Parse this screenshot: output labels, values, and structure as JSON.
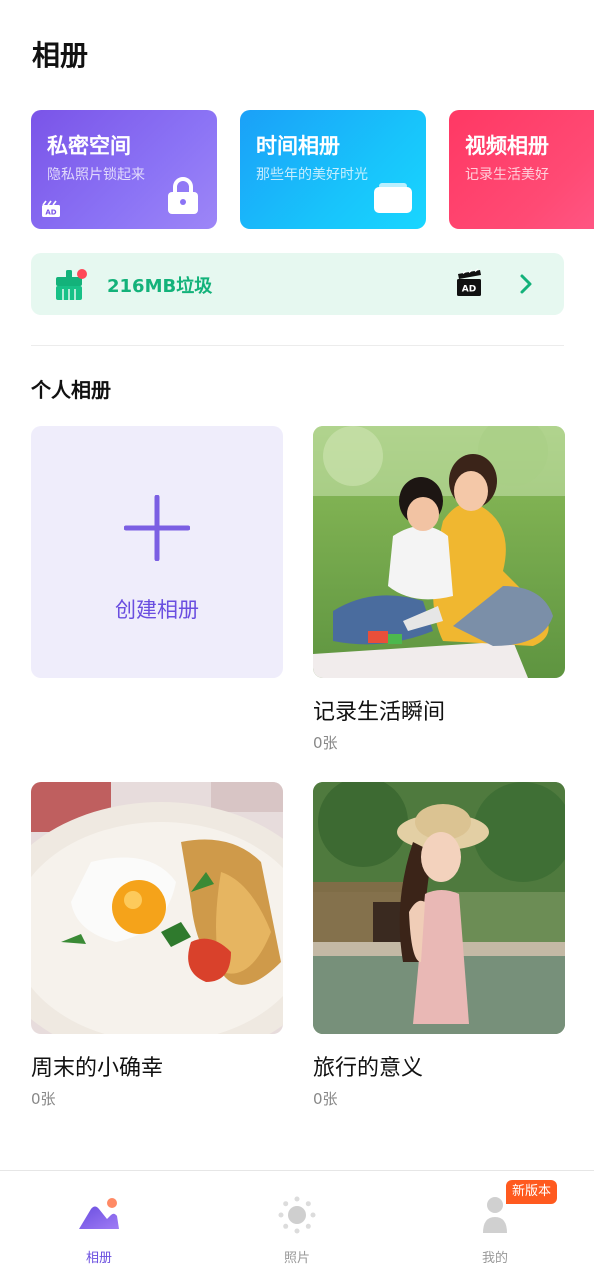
{
  "header": {
    "title": "相册"
  },
  "feature_cards": [
    {
      "title": "私密空间",
      "subtitle": "隐私照片锁起来",
      "ad": "AD",
      "icon": "lock-icon"
    },
    {
      "title": "时间相册",
      "subtitle": "那些年的美好时光",
      "icon": "folder-icon"
    },
    {
      "title": "视频相册",
      "subtitle": "记录生活美好",
      "icon": "film-icon"
    }
  ],
  "cleaner": {
    "text": "216MB垃圾",
    "ad": "AD",
    "icon": "broom-icon"
  },
  "section": {
    "title": "个人相册"
  },
  "create_album": {
    "label": "创建相册"
  },
  "albums": [
    {
      "name": "记录生活瞬间",
      "count": "0张"
    },
    {
      "name": "周末的小确幸",
      "count": "0张"
    },
    {
      "name": "旅行的意义",
      "count": "0张"
    }
  ],
  "tabbar": {
    "tabs": [
      {
        "label": "相册",
        "active": true
      },
      {
        "label": "照片",
        "active": false
      },
      {
        "label": "我的",
        "active": false
      }
    ],
    "new_badge": "新版本"
  },
  "colors": {
    "accent": "#6a4ee0",
    "green": "#13b27a",
    "badge": "#ff5a1f"
  }
}
